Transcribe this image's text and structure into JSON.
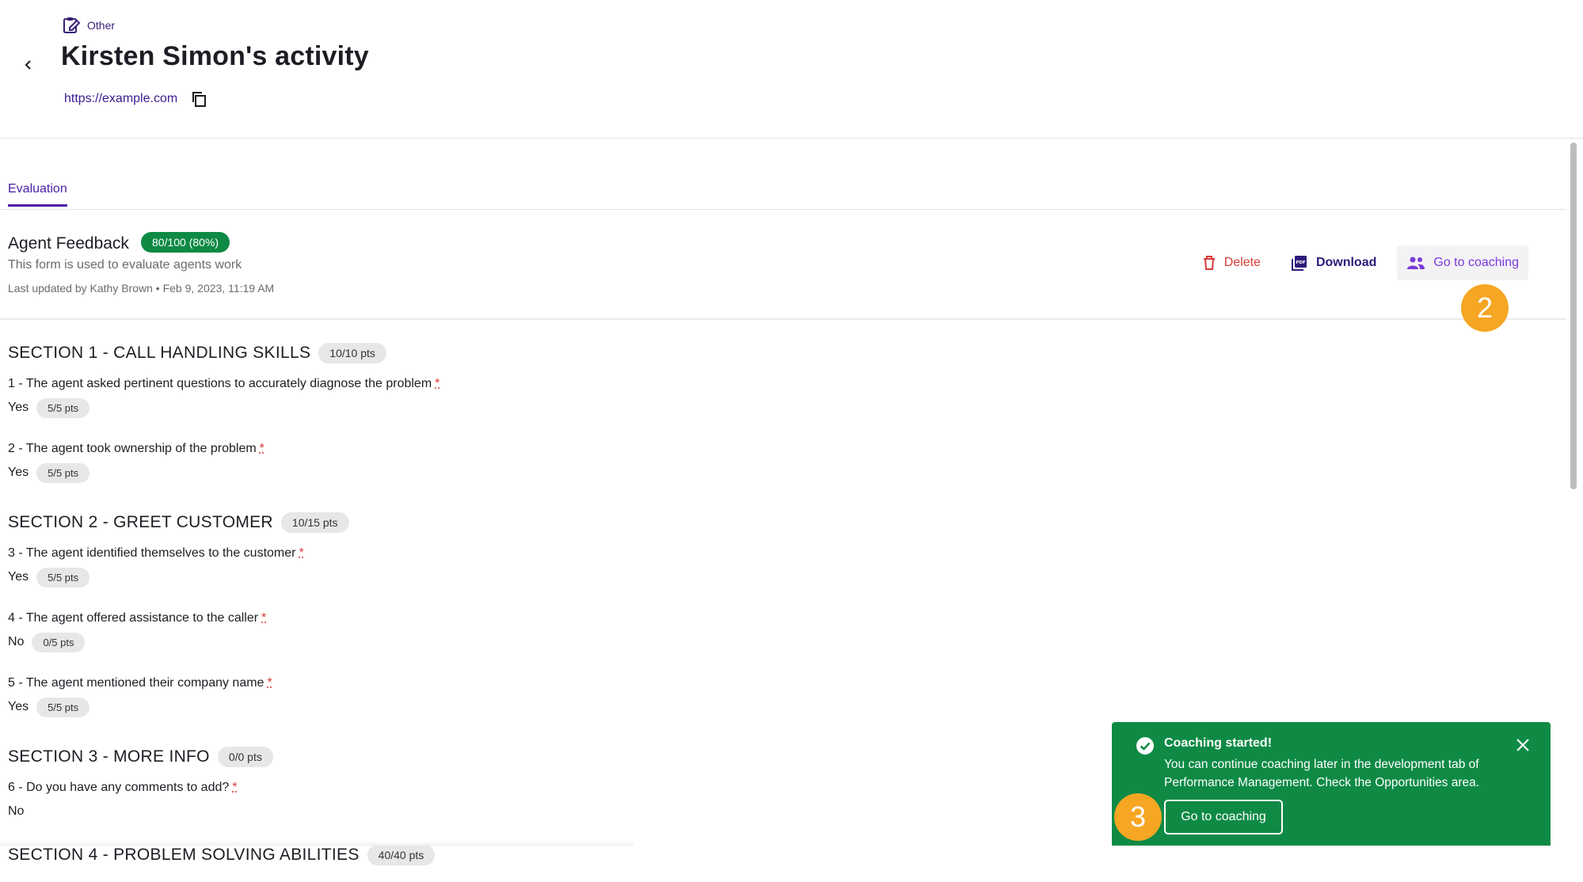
{
  "header": {
    "category": "Other",
    "title": "Kirsten Simon's activity",
    "link": "https://example.com"
  },
  "tabs": [
    {
      "label": "Evaluation",
      "active": true
    }
  ],
  "form": {
    "title": "Agent Feedback",
    "score": "80/100 (80%)",
    "description": "This form is used to evaluate agents work",
    "updated": "Last updated by Kathy Brown • Feb 9, 2023, 11:19 AM",
    "actions": {
      "delete": "Delete",
      "download": "Download",
      "coach": "Go to coaching"
    }
  },
  "steps": {
    "a": "2",
    "b": "3"
  },
  "sections": [
    {
      "title": "SECTION 1 - CALL HANDLING SKILLS",
      "pts": "10/10 pts",
      "questions": [
        {
          "label": "1 - The agent asked pertinent questions to accurately diagnose the problem",
          "required": "*",
          "answer": "Yes",
          "pts": "5/5 pts"
        },
        {
          "label": "2 - The agent took ownership of the problem",
          "required": "*",
          "answer": "Yes",
          "pts": "5/5 pts"
        }
      ]
    },
    {
      "title": "SECTION 2 - GREET CUSTOMER",
      "pts": "10/15 pts",
      "questions": [
        {
          "label": "3 - The agent identified themselves to the customer",
          "required": "*",
          "answer": "Yes",
          "pts": "5/5 pts"
        },
        {
          "label": "4 - The agent offered assistance to the caller",
          "required": "*",
          "answer": "No",
          "pts": "0/5 pts"
        },
        {
          "label": "5 - The agent mentioned their company name",
          "required": "*",
          "answer": "Yes",
          "pts": "5/5 pts"
        }
      ]
    },
    {
      "title": "SECTION 3 - MORE INFO",
      "pts": "0/0 pts",
      "questions": [
        {
          "label": "6 - Do you have any comments to add?",
          "required": "*",
          "answer": "No"
        }
      ]
    },
    {
      "title": "SECTION 4 - PROBLEM SOLVING ABILITIES",
      "pts": "40/40 pts"
    }
  ],
  "toast": {
    "title": "Coaching started!",
    "body": "You can continue coaching later in the development tab of Performance Management. Check the Opportunities area.",
    "button": "Go to coaching"
  },
  "colors": {
    "accent": "#4a1fa6",
    "success": "#0e8a45",
    "danger": "#d93a3a",
    "step": "#f5a623"
  }
}
